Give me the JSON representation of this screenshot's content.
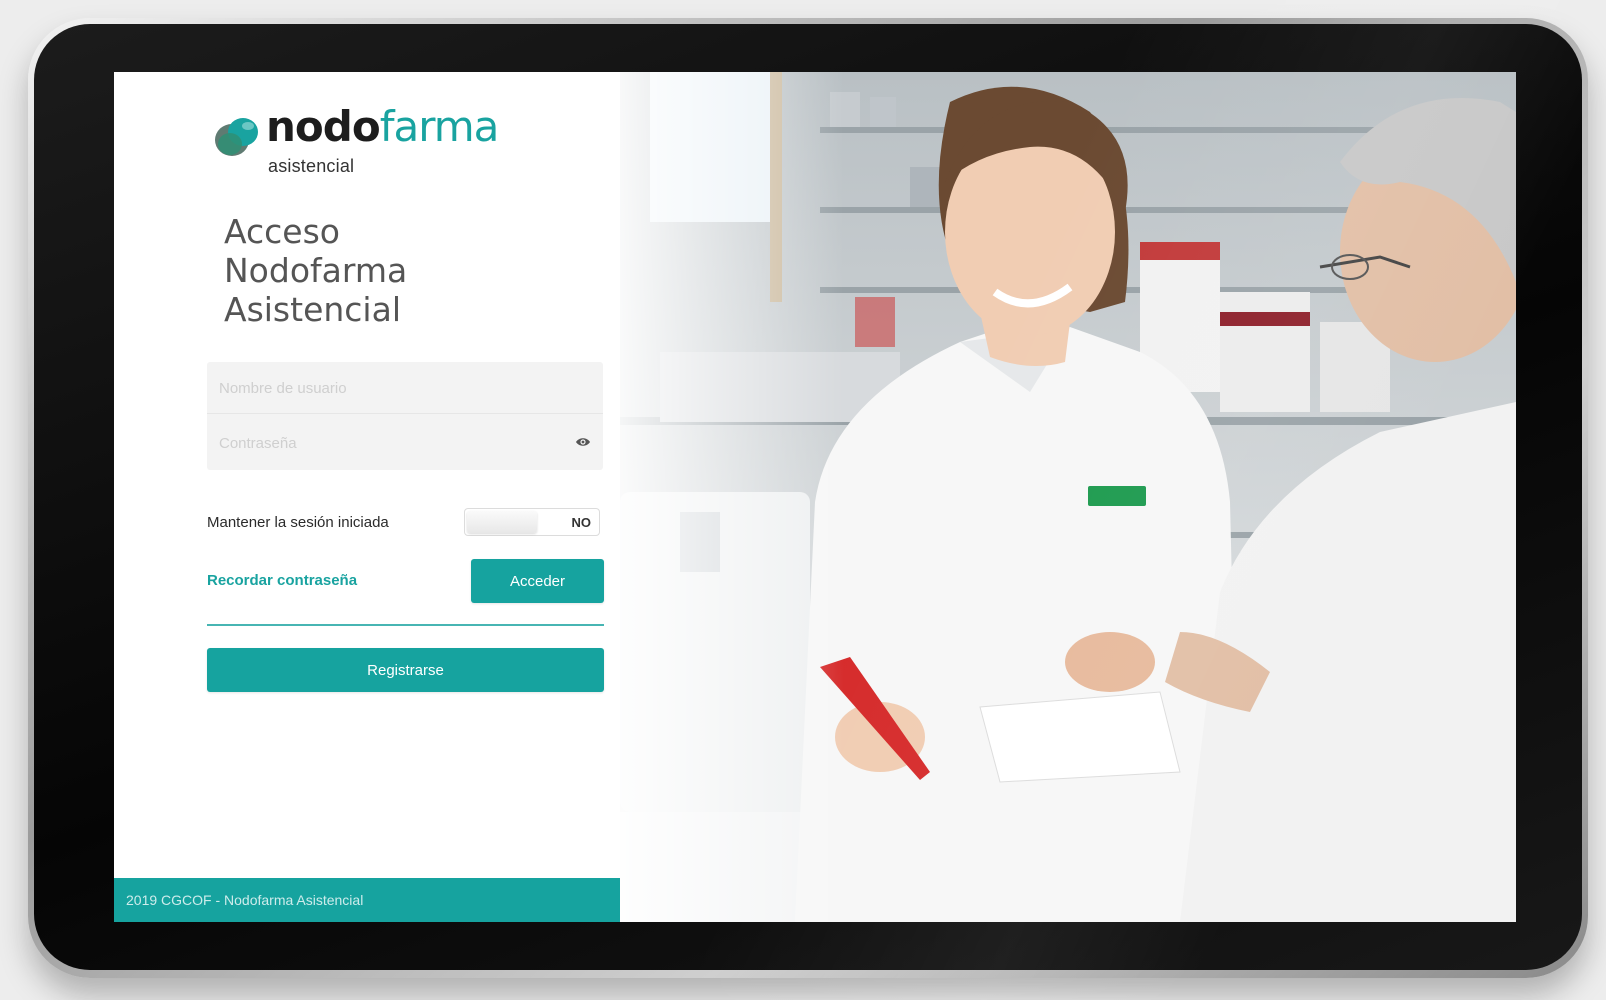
{
  "brand": {
    "word_dark": "nodo",
    "word_accent": "farma",
    "subtitle": "asistencial",
    "accent_color": "#16a39f"
  },
  "login": {
    "title_lines": [
      "Acceso",
      "Nodofarma",
      "Asistencial"
    ],
    "username_placeholder": "Nombre de usuario",
    "password_placeholder": "Contraseña",
    "password_toggle_icon": "eye-icon",
    "keep_session_label": "Mantener la sesión iniciada",
    "keep_session_value": "NO",
    "forgot_link": "Recordar contraseña",
    "login_button": "Acceder",
    "register_button": "Registrarse"
  },
  "footer": {
    "text": "2019 CGCOF - Nodofarma Asistencial"
  }
}
